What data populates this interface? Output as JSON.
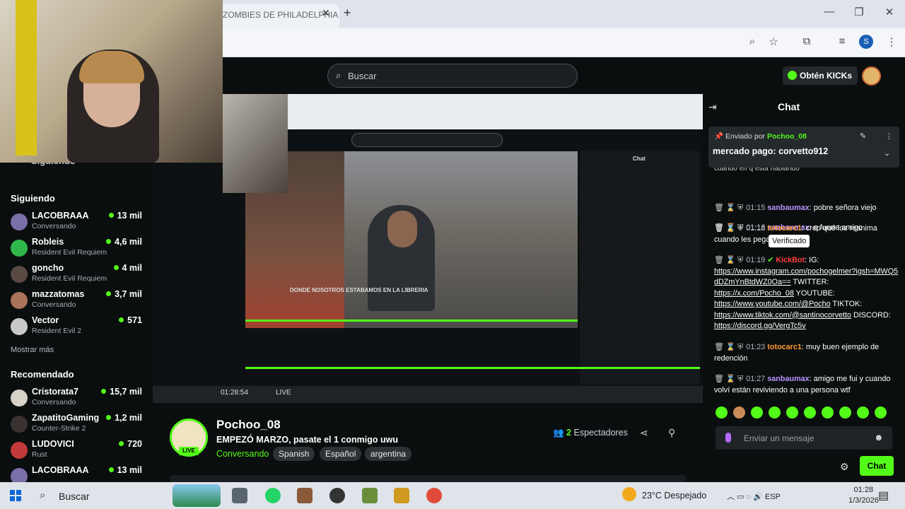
{
  "browser": {
    "tab_title": "ZOMBIES DE PHILADELPHIA",
    "tab_close": "✕",
    "new_tab": "+",
    "window_minimize": "—",
    "window_restore": "❐",
    "window_close": "✕",
    "profile_initial": "S"
  },
  "header": {
    "search_placeholder": "Buscar",
    "get_kicks_label": "Obtén KICKs"
  },
  "sidebar": {
    "following_partial_label": "Siguiendo",
    "following_label": "Siguiendo",
    "show_more_label": "Mostrar más",
    "recommended_label": "Recomendado",
    "following": [
      {
        "name": "LACOBRAAA",
        "activity": "Conversando",
        "viewers": "13 mil",
        "avatar_color": "#7b6fa8"
      },
      {
        "name": "Robleis",
        "activity": "Resident Evil Requiem",
        "viewers": "4,6 mil",
        "avatar_color": "#2fb84a"
      },
      {
        "name": "goncho",
        "activity": "Resident Evil Requiem",
        "viewers": "4 mil",
        "avatar_color": "#5a4a44"
      },
      {
        "name": "mazzatomas",
        "activity": "Conversando",
        "viewers": "3,7 mil",
        "avatar_color": "#a9745a"
      },
      {
        "name": "Vector",
        "activity": "Resident Evil 2",
        "viewers": "571",
        "avatar_color": "#c9c9c9"
      }
    ],
    "recommended": [
      {
        "name": "Cristorata7",
        "activity": "Conversando",
        "viewers": "15,7 mil",
        "avatar_color": "#d7d2c8"
      },
      {
        "name": "ZapatitoGaming",
        "activity": "Counter-Strike 2",
        "viewers": "1,2 mil",
        "avatar_color": "#3a3230"
      },
      {
        "name": "LUDOVICI",
        "activity": "Rust",
        "viewers": "720",
        "avatar_color": "#c23a3a"
      },
      {
        "name": "LACOBRAAA",
        "activity": "",
        "viewers": "13 mil",
        "avatar_color": "#7b6fa8"
      }
    ]
  },
  "stream": {
    "streamer_name": "Pochoo_08",
    "live_badge": "LIVE",
    "title": "EMPEZÓ MARZO, pasate el 1 conmigo uwu",
    "category": "Conversando",
    "tags": [
      "Spanish",
      "Español",
      "argentina"
    ],
    "viewers_count": "2",
    "viewers_label": "Espectadores",
    "embedded_caption": "DONDE NOSOTROS ESTABAMOS EN LA LIBRERIA",
    "embedded_time": "01:28:54",
    "embedded_live": "LIVE"
  },
  "chat": {
    "title": "Chat",
    "pinned_by_prefix": "Enviado por",
    "pinned_by_user": "Pochoo_08",
    "pinned_message": "mercado pago: corvetto912",
    "partial_top_message": "cuando en q esta hablando",
    "tooltip": "Verificado",
    "messages": [
      {
        "time": "01:15",
        "user": "sanbaumax",
        "text": ": pobre señora viejo",
        "color": "purple"
      },
      {
        "time": "01:16",
        "user": "sanbaumax",
        "text": ": q fuerte amigo",
        "color": "purple"
      },
      {
        "time": "01:18",
        "user": "totocarc1",
        "text": ": creo que los reanima cuando les pega",
        "color": "orange"
      },
      {
        "time": "01:19",
        "user": "KickBot",
        "text": ": IG:",
        "color": "red"
      },
      {
        "time": "01:23",
        "user": "totocarc1",
        "text": ": muy buen ejemplo de redención",
        "color": "orange"
      },
      {
        "time": "01:27",
        "user": "sanbaumax",
        "text": ": amigo me fui y cuando volví están reviviendo a una persona wtf",
        "color": "purple"
      }
    ],
    "kickbot_links": {
      "ig_url": "https://www.instagram.com/pochogelmer?igsh=MWQ5dDZmYnBtdWZ0Oa==",
      "twitter_label": "TWITTER:",
      "twitter_url": "https://x.com/Pocho_08",
      "youtube_label": "YOUTUBE:",
      "youtube_url": "https://www.youtube.com/@Pocho",
      "tiktok_label": "TIKTOK:",
      "tiktok_url": "https://www.tiktok.com/@santinocorvetto",
      "discord_label": "DISCORD:",
      "discord_url": "https://discord.gg/VergTc5v"
    },
    "input_placeholder": "Enviar un mensaje",
    "send_label": "Chat"
  },
  "taskbar": {
    "search_label": "Buscar",
    "weather": "23°C  Despejado",
    "language": "ESP",
    "time": "01:28",
    "date": "1/3/2026"
  },
  "colors": {
    "kick_green": "#53fc18",
    "bg": "#0b0e0f",
    "username_purple": "#b796ff",
    "username_orange": "#ff9a2e",
    "username_red": "#ff3b3b"
  }
}
